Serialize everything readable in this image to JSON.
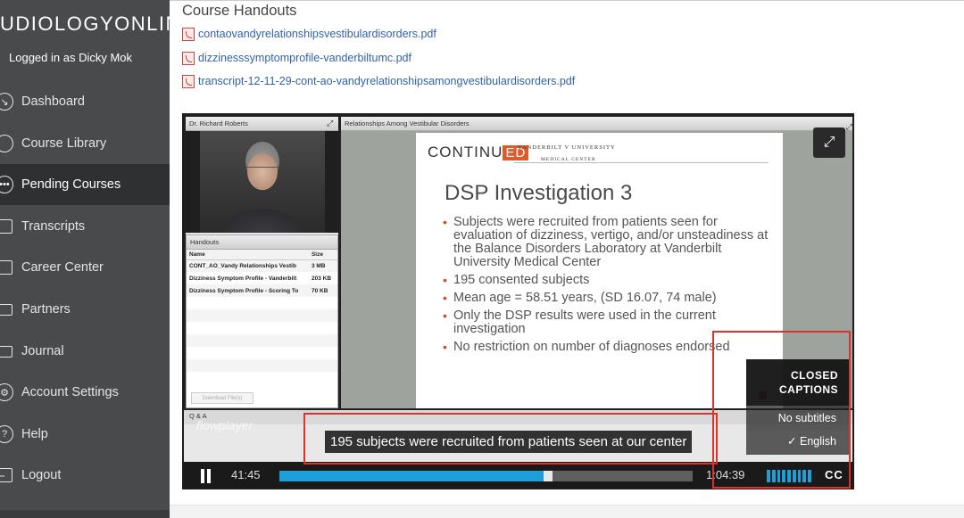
{
  "sidebar": {
    "brand": "UDIOLOGYONLINE",
    "logged_in": "Logged in as Dicky Mok",
    "items": [
      {
        "label": "Dashboard",
        "icon": "dashboard-icon"
      },
      {
        "label": "Course Library",
        "icon": "library-icon"
      },
      {
        "label": "Pending Courses",
        "icon": "pending-icon",
        "active": true
      },
      {
        "label": "Transcripts",
        "icon": "transcripts-icon"
      },
      {
        "label": "Career Center",
        "icon": "briefcase-icon"
      },
      {
        "label": "Partners",
        "icon": "folder-icon"
      },
      {
        "label": "Journal",
        "icon": "journal-icon"
      },
      {
        "label": "Account Settings",
        "icon": "gear-icon"
      },
      {
        "label": "Help",
        "icon": "help-icon"
      },
      {
        "label": "Logout",
        "icon": "logout-icon"
      }
    ]
  },
  "handouts": {
    "title": "Course Handouts",
    "files": [
      "contaovandyrelationshipsvestibulardisorders.pdf",
      "dizzinesssymptomprofile-vanderbiltumc.pdf",
      "transcript-12-11-29-cont-ao-vandyrelationshipsamongvestibulardisorders.pdf"
    ]
  },
  "player": {
    "speaker_panel_title": "Dr. Richard Roberts",
    "slides_panel_title": "Relationships Among Vestibular Disorders",
    "handouts_panel": {
      "title": "Handouts",
      "columns": [
        "Name",
        "Size"
      ],
      "rows": [
        [
          "CONT_AO_Vandy Relationships Vestib",
          "3 MB"
        ],
        [
          "Dizziness Symptom Profile - Vanderbilt",
          "203 KB"
        ],
        [
          "Dizziness Symptom Profile - Scoring To",
          "70 KB"
        ]
      ],
      "download_label": "Download File(s)"
    },
    "slide": {
      "logo_left": "CONTINU",
      "logo_ed": "ED",
      "logo_vandy": "VANDERBILT V UNIVERSITY",
      "logo_vandy_sub": "MEDICAL CENTER",
      "title": "DSP Investigation 3",
      "bullets": [
        "Subjects were recruited from patients seen for evaluation of dizziness, vertigo, and/or unsteadiness at the Balance Disorders Laboratory at Vanderbilt University Medical Center",
        "195 consented subjects",
        "Mean age = 58.51 years, (SD 16.07, 74 male)",
        "Only the DSP results were used in the current investigation",
        "No restriction on number of diagnoses endorsed"
      ]
    },
    "qa_label": "Q & A",
    "watermark": "flowplayer",
    "caption": "195 subjects were recruited from patients seen at our center",
    "cc_menu": {
      "title_line1": "CLOSED",
      "title_line2": "CAPTIONS",
      "option_none": "No subtitles",
      "option_selected": "✓ English"
    },
    "controls": {
      "time_current": "41:45",
      "time_duration": "1:04:39",
      "cc_label": "CC",
      "progress_fraction": 0.64,
      "buffer_fraction": 0.66,
      "volume_bars": 9
    },
    "accent_color": "#1e9fd9"
  }
}
